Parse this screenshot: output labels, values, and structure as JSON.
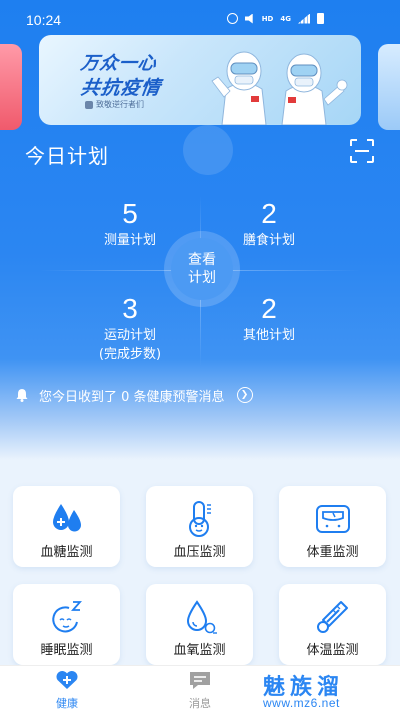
{
  "status_bar": {
    "time": "10:24",
    "hd": "HD",
    "net": "4G"
  },
  "banner": {
    "title_line1": "万众一心",
    "title_line2": "共抗疫情",
    "subtitle": "致敬逆行者们"
  },
  "plan": {
    "title": "今日计划",
    "center_button_line1": "查看",
    "center_button_line2": "计划",
    "stats": [
      {
        "value": "5",
        "label": "测量计划"
      },
      {
        "value": "2",
        "label": "膳食计划"
      },
      {
        "value": "3",
        "label": "运动计划",
        "sublabel": "(完成步数)"
      },
      {
        "value": "2",
        "label": "其他计划"
      }
    ]
  },
  "notice": {
    "text": "您今日收到了 0 条健康预警消息"
  },
  "monitors": [
    {
      "label": "血糖监测",
      "icon": "blood-drop-plus-icon"
    },
    {
      "label": "血压监测",
      "icon": "thermometer-face-icon"
    },
    {
      "label": "体重监测",
      "icon": "scale-icon"
    },
    {
      "label": "睡眠监测",
      "icon": "sleep-face-icon"
    },
    {
      "label": "血氧监测",
      "icon": "oxygen-drop-icon"
    },
    {
      "label": "体温监测",
      "icon": "thermometer-icon"
    }
  ],
  "tabbar": {
    "health": "健康",
    "messages": "消息"
  },
  "watermark": {
    "main": "魅族溜",
    "url": "www.mz6.net"
  },
  "colors": {
    "primary": "#2b86f2",
    "icon_blue": "#1f7ef0",
    "inactive": "#999999"
  }
}
